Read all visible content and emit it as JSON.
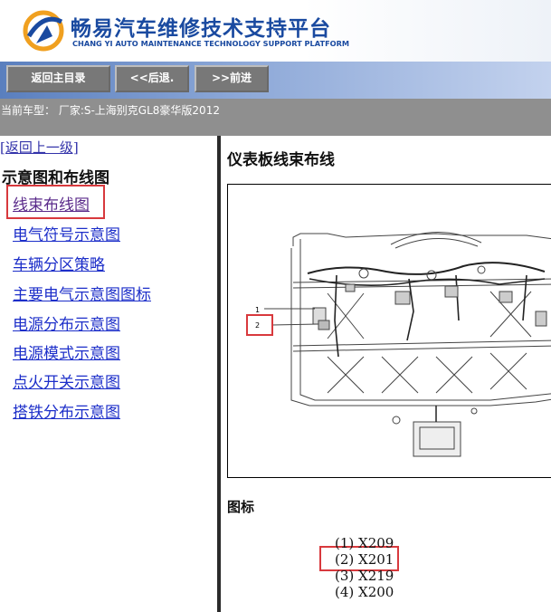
{
  "header": {
    "title_cn": "畅易汽车维修技术支持平台",
    "title_en": "CHANG YI AUTO MAINTENANCE TECHNOLOGY SUPPORT PLATFORM",
    "logo_icon": "cy-logo-icon"
  },
  "nav": {
    "home_label": "返回主目录",
    "back_label": "<<后退.",
    "forward_label": ">>前进"
  },
  "vehicle_bar": {
    "text": "当前车型：  厂家:S-上海别克GL8豪华版2012"
  },
  "left_panel": {
    "back_link": "[返回上一级]",
    "section_title": "示意图和布线图",
    "items": [
      {
        "label": "线束布线图",
        "active": true
      },
      {
        "label": "电气符号示意图",
        "active": false
      },
      {
        "label": "车辆分区策略",
        "active": false
      },
      {
        "label": "主要电气示意图图标",
        "active": false
      },
      {
        "label": "电源分布示意图",
        "active": false
      },
      {
        "label": "电源模式示意图",
        "active": false
      },
      {
        "label": "点火开关示意图",
        "active": false
      },
      {
        "label": "搭铁分布示意图",
        "active": false
      }
    ]
  },
  "content": {
    "title": "仪表板线束布线",
    "figure_callouts": [
      "1",
      "2"
    ],
    "legend_title": "图标",
    "legend": [
      "(1) X209",
      "(2) X201",
      "(3) X219",
      "(4) X200"
    ]
  },
  "colors": {
    "brand_blue": "#1a4aa0",
    "nav_start": "#5a7fbe",
    "nav_end": "#c3d2ee",
    "button_gray": "#787878",
    "vehicle_bar": "#8f8f8f",
    "link_blue": "#1c2ec9",
    "visited_purple": "#5a2a8a",
    "highlight_red": "#d8393d"
  }
}
